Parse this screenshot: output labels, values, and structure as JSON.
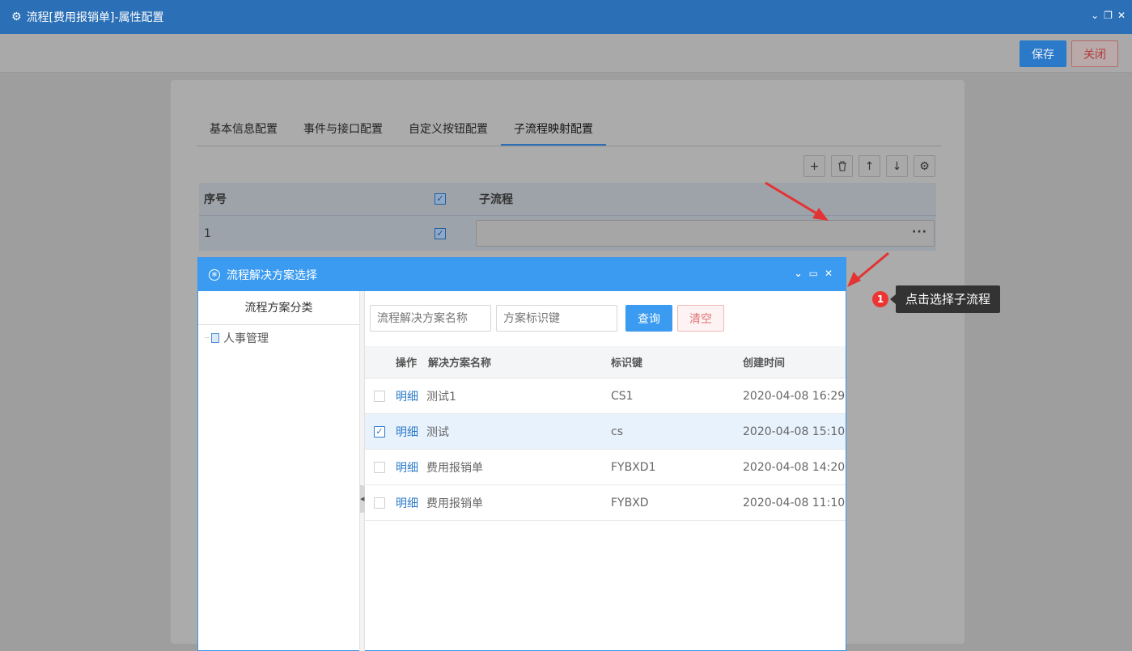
{
  "window": {
    "title": "流程[费用报销单]-属性配置"
  },
  "toolbar": {
    "save_label": "保存",
    "close_label": "关闭"
  },
  "tabs": [
    {
      "label": "基本信息配置"
    },
    {
      "label": "事件与接口配置"
    },
    {
      "label": "自定义按钮配置"
    },
    {
      "label": "子流程映射配置",
      "active": true
    }
  ],
  "grid": {
    "headers": {
      "seq": "序号",
      "subflow": "子流程"
    },
    "rows": [
      {
        "seq": "1",
        "subflow": ""
      }
    ],
    "more": "···"
  },
  "annotation": {
    "badge": "1",
    "text": "点击选择子流程",
    "color": "#e33333"
  },
  "dialog": {
    "title": "流程解决方案选择",
    "category_title": "流程方案分类",
    "tree": [
      {
        "label": "人事管理"
      }
    ],
    "search": {
      "name_placeholder": "流程解决方案名称",
      "key_placeholder": "方案标识键",
      "query_label": "查询",
      "clear_label": "清空"
    },
    "table": {
      "headers": {
        "op": "操作",
        "name": "解决方案名称",
        "key": "标识键",
        "time": "创建时间"
      },
      "rows": [
        {
          "op": "明细",
          "name": "测试1",
          "key": "CS1",
          "time": "2020-04-08 16:29:",
          "checked": false
        },
        {
          "op": "明细",
          "name": "测试",
          "key": "cs",
          "time": "2020-04-08 15:10:",
          "checked": true
        },
        {
          "op": "明细",
          "name": "费用报销单",
          "key": "FYBXD1",
          "time": "2020-04-08 14:20:",
          "checked": false
        },
        {
          "op": "明细",
          "name": "费用报销单",
          "key": "FYBXD",
          "time": "2020-04-08 11:10:",
          "checked": false
        }
      ]
    }
  },
  "colors": {
    "primary": "#2b6fb6",
    "dialog_header": "#3a9bf0",
    "danger": "#e37272"
  }
}
